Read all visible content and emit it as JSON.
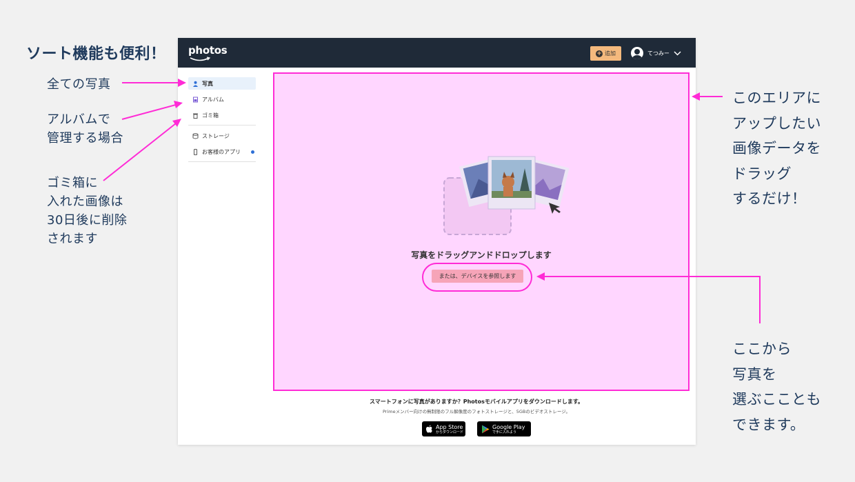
{
  "callouts": {
    "sort": "ソート機能も便利！",
    "all_photos": "全ての写真",
    "album": "アルバムで\n管理する場合",
    "trash": "ゴミ箱に\n入れた画像は\n30日後に削除\nされます",
    "drop": "このエリアに\nアップしたい\n画像データを\nドラッグ\nするだけ！",
    "pick": "ここから\n写真を\n選ぶこことも\nできます。"
  },
  "header": {
    "logo": "photos",
    "add_label": "追加",
    "user_name": "てつみー"
  },
  "sidebar": {
    "items": [
      {
        "label": "写真",
        "icon": "person-icon"
      },
      {
        "label": "アルバム",
        "icon": "album-icon"
      },
      {
        "label": "ゴミ箱",
        "icon": "trash-icon"
      },
      {
        "label": "ストレージ",
        "icon": "storage-icon"
      },
      {
        "label": "お客様のアプリ",
        "icon": "phone-icon"
      }
    ]
  },
  "dropzone": {
    "title": "写真をドラッグアンドドロップします",
    "browse_label": "または、デバイスを参照します"
  },
  "footer": {
    "title": "スマートフォンに写真がありますか？Photosモバイルアプリをダウンロードします。",
    "subtitle": "Primeメンバー向けの無制限のフル解像度のフォトストレージと、5GBのビデオストレージ。",
    "app_store": {
      "big": "App Store",
      "small": "からダウンロード"
    },
    "google_play": {
      "big": "Google Play",
      "small": "で手に入れよう"
    }
  },
  "colors": {
    "accent": "#ff2bd6",
    "topbar": "#1f2a38",
    "dropzone_bg": "#ffd6ff",
    "add_button": "#f4b97d"
  }
}
